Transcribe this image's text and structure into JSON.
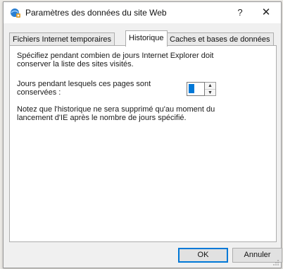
{
  "window": {
    "title": "Paramètres des données du site Web",
    "help_label": "?",
    "close_label": "✕"
  },
  "tabs": [
    {
      "label": "Fichiers Internet temporaires",
      "active": false
    },
    {
      "label": "Historique",
      "active": true
    },
    {
      "label": "Caches et bases de données",
      "active": false
    }
  ],
  "historique": {
    "intro": "Spécifiez pendant combien de jours Internet Explorer doit conserver la liste des sites visités.",
    "days_label": "Jours pendant lesquels ces pages sont conservées :",
    "days_value": "0",
    "note": "Notez que l'historique ne sera supprimé qu'au moment du lancement d'IE après le nombre de jours spécifié."
  },
  "buttons": {
    "ok": "OK",
    "cancel": "Annuler"
  },
  "icons": {
    "app": "ie-settings-icon",
    "spin_up": "arrow-up-icon",
    "spin_down": "arrow-down-icon"
  },
  "colors": {
    "accent": "#0078d7",
    "panel": "#ffffff",
    "dialog": "#f0f0f0"
  }
}
